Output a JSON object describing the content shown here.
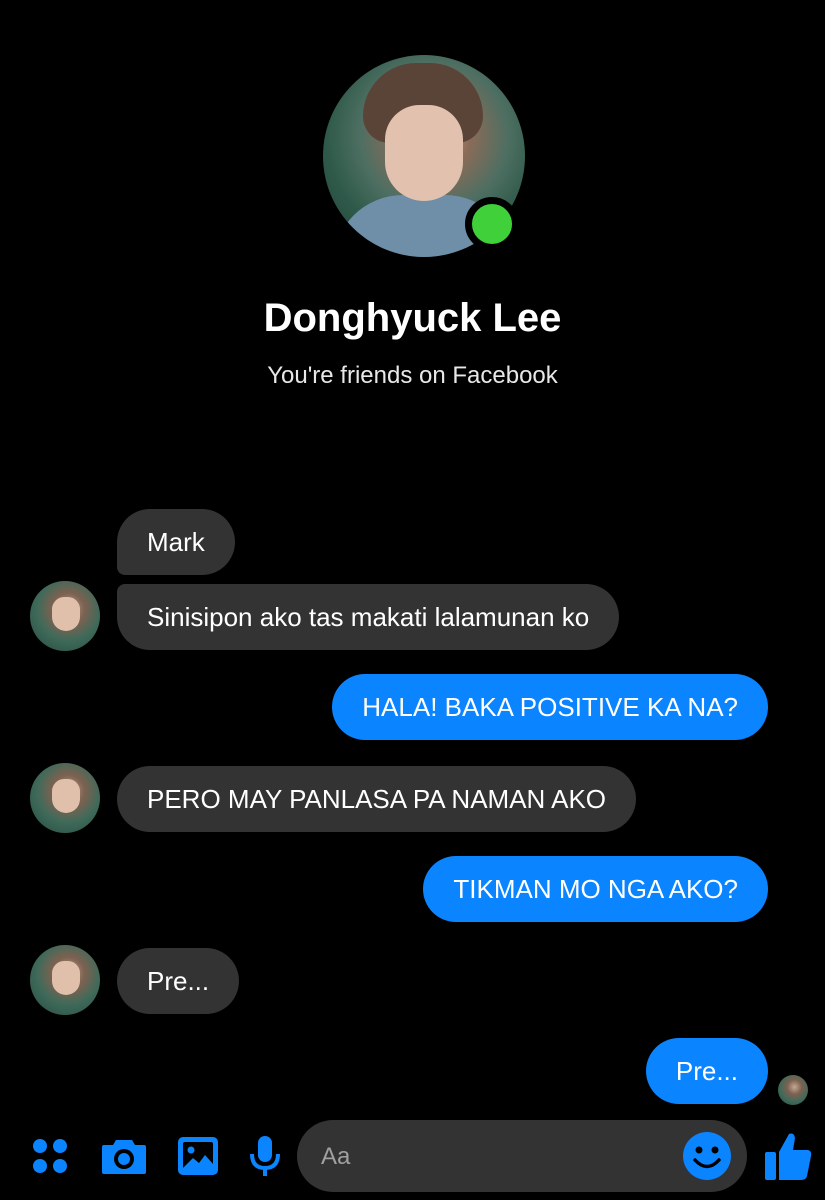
{
  "profile": {
    "name": "Donghyuck Lee",
    "subtitle": "You're friends on Facebook",
    "online": true
  },
  "messages": [
    {
      "side": "in",
      "text": "Mark"
    },
    {
      "side": "in",
      "text": "Sinisipon ako tas makati lalamunan ko"
    },
    {
      "side": "out",
      "text": "HALA! BAKA POSITIVE KA NA?"
    },
    {
      "side": "in",
      "text": "PERO MAY PANLASA PA NAMAN AKO"
    },
    {
      "side": "out",
      "text": "TIKMAN MO NGA AKO?"
    },
    {
      "side": "in",
      "text": "Pre..."
    },
    {
      "side": "out",
      "text": "Pre..."
    }
  ],
  "composer": {
    "placeholder": "Aa"
  },
  "toolbar": {
    "icons": [
      "apps-icon",
      "camera-icon",
      "gallery-icon",
      "microphone-icon",
      "emoji-icon",
      "thumbs-up-icon"
    ]
  },
  "colors": {
    "background": "#000000",
    "accent": "#0b84ff",
    "incoming_bubble": "#333333",
    "online": "#3fd03a"
  }
}
